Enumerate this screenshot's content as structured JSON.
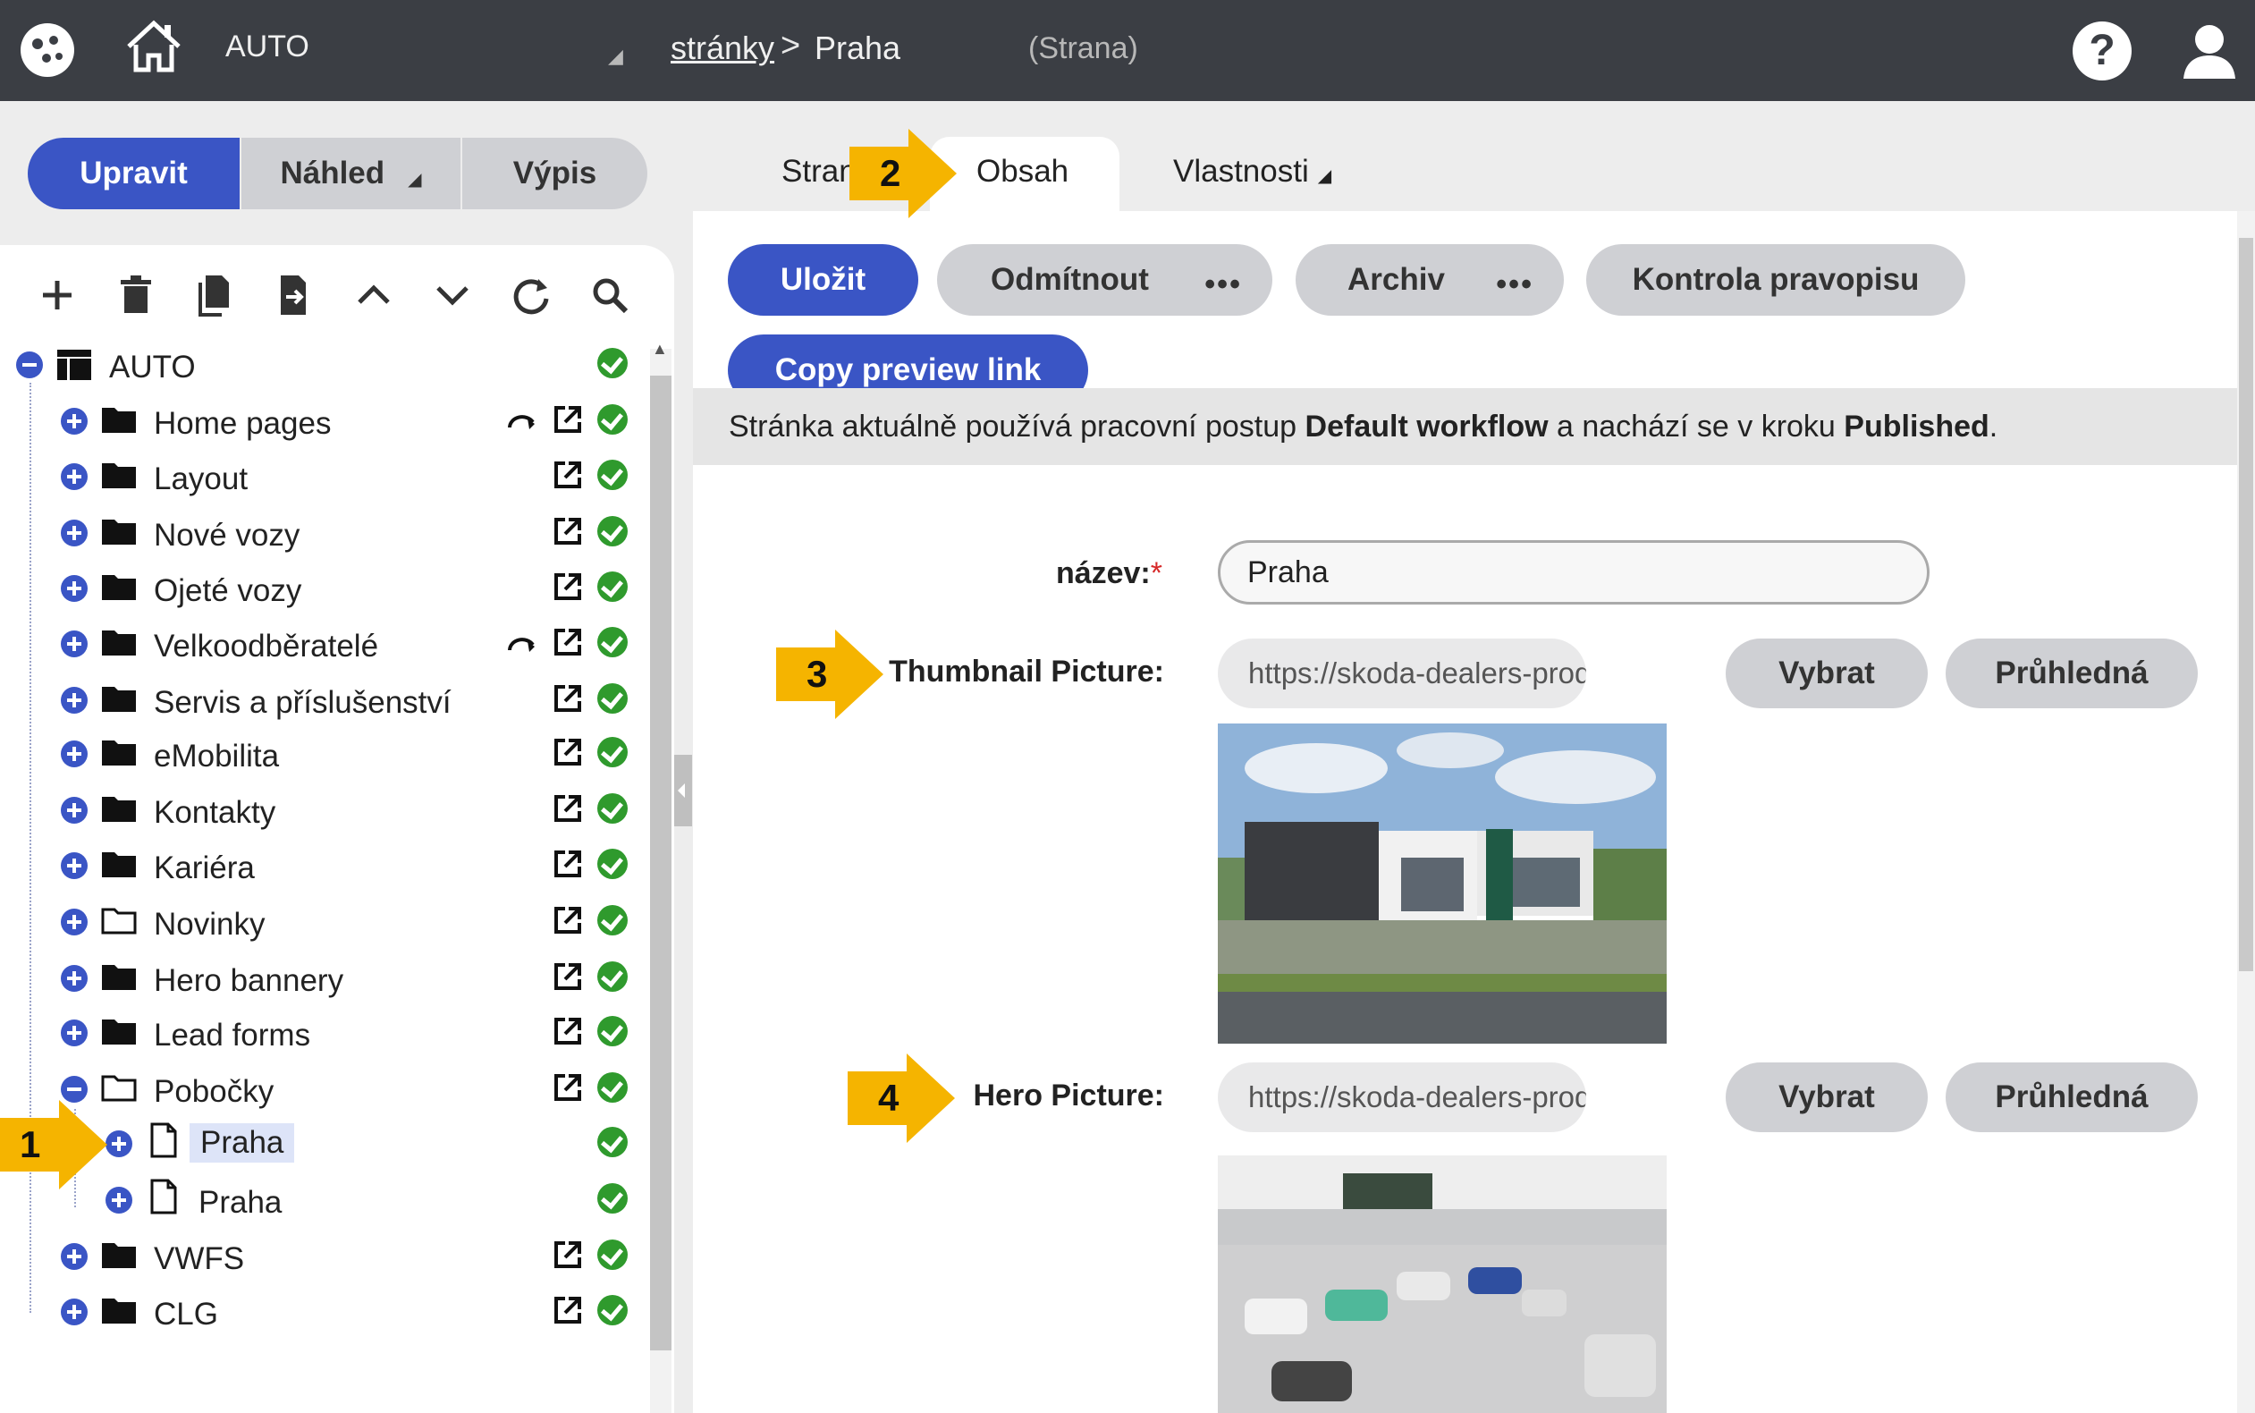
{
  "header": {
    "app_name": "AUTO",
    "breadcrumb_link": "stránky",
    "breadcrumb_separator": ">",
    "breadcrumb_current": "Praha",
    "page_kind": "(Strana)",
    "help_label": "?"
  },
  "modes": {
    "edit": "Upravit",
    "preview": "Náhled",
    "list": "Výpis"
  },
  "tree": {
    "root": "AUTO",
    "items": [
      {
        "label": "Home pages"
      },
      {
        "label": "Layout"
      },
      {
        "label": "Nové vozy"
      },
      {
        "label": "Ojeté vozy"
      },
      {
        "label": "Velkoodběratelé"
      },
      {
        "label": "Servis a příslušenství"
      },
      {
        "label": "eMobilita"
      },
      {
        "label": "Kontakty"
      },
      {
        "label": "Kariéra"
      },
      {
        "label": "Novinky"
      },
      {
        "label": "Hero bannery"
      },
      {
        "label": "Lead forms"
      },
      {
        "label": "Pobočky"
      },
      {
        "label": "Praha"
      },
      {
        "label": "Praha"
      },
      {
        "label": "VWFS"
      },
      {
        "label": "CLG"
      }
    ]
  },
  "tabs": {
    "page": "Strana",
    "content": "Obsah",
    "properties": "Vlastnosti"
  },
  "actions": {
    "save": "Uložit",
    "reject": "Odmítnout",
    "archive": "Archiv",
    "spellcheck": "Kontrola pravopisu",
    "copy_preview": "Copy preview link",
    "more": "•••"
  },
  "notice": {
    "before": "Stránka aktuálně používá pracovní postup ",
    "workflow": "Default workflow",
    "middle": " a nachází se v kroku ",
    "step": "Published",
    "after": "."
  },
  "form": {
    "name_label": "název:",
    "name_required": "*",
    "name_value": "Praha",
    "thumb_label": "Thumbnail Picture:",
    "thumb_url": "https://skoda-dealers-prod-c...",
    "hero_label": "Hero Picture:",
    "hero_url": "https://skoda-dealers-prod-c...",
    "select_label": "Vybrat",
    "transparent_label": "Průhledná"
  },
  "callouts": {
    "c1": "1",
    "c2": "2",
    "c3": "3",
    "c4": "4"
  },
  "colors": {
    "primary": "#3a55c5",
    "topbar": "#3b3e44",
    "ok": "#2f9a2d",
    "callout": "#f5b400"
  }
}
